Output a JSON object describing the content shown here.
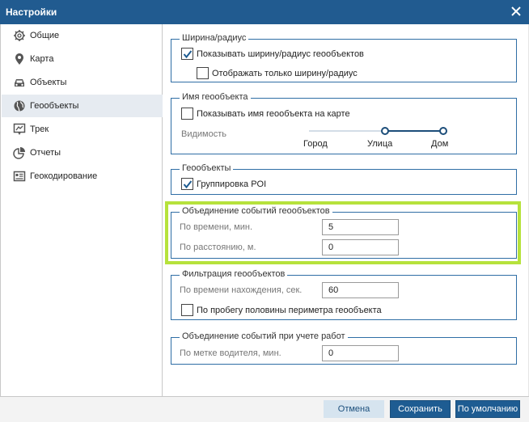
{
  "window": {
    "title": "Настройки"
  },
  "sidebar": {
    "items": [
      {
        "label": "Общие",
        "icon": "gear-icon"
      },
      {
        "label": "Карта",
        "icon": "map-pin-icon"
      },
      {
        "label": "Объекты",
        "icon": "car-icon"
      },
      {
        "label": "Геообъекты",
        "icon": "globe-icon",
        "active": true
      },
      {
        "label": "Трек",
        "icon": "track-icon"
      },
      {
        "label": "Отчеты",
        "icon": "pie-chart-icon"
      },
      {
        "label": "Геокодирование",
        "icon": "address-card-icon"
      }
    ]
  },
  "width_radius": {
    "legend": "Ширина/радиус",
    "show_width": {
      "label": "Показывать ширину/радиус геообъектов",
      "checked": true
    },
    "only_width": {
      "label": "Отображать только ширину/радиус",
      "checked": false
    }
  },
  "geo_name": {
    "legend": "Имя геообъекта",
    "show_name": {
      "label": "Показывать имя геообъекта на карте",
      "checked": false
    },
    "visibility": {
      "label": "Видимость",
      "ticks": [
        "Город",
        "Улица",
        "Дом"
      ],
      "range": [
        "Улица",
        "Дом"
      ]
    }
  },
  "geoobjects": {
    "legend": "Геообъекты",
    "grouping": {
      "label": "Группировка POI",
      "checked": true
    }
  },
  "merge_events": {
    "legend": "Объединение событий геообъектов",
    "by_time": {
      "label": "По времени, мин.",
      "value": "5"
    },
    "by_distance": {
      "label": "По расстоянию, м.",
      "value": "0"
    }
  },
  "filtering": {
    "legend": "Фильтрация геообъектов",
    "by_stay_time": {
      "label": "По времени нахождения, сек.",
      "value": "60"
    },
    "by_perimeter": {
      "label": "По пробегу половины периметра геообъекта",
      "checked": false
    }
  },
  "merge_work": {
    "legend": "Объединение событий при учете работ",
    "by_driver": {
      "label": "По метке водителя, мин.",
      "value": "0"
    }
  },
  "footer": {
    "cancel": "Отмена",
    "save": "Сохранить",
    "default": "По умолчанию"
  },
  "colors": {
    "titlebar": "#215b90",
    "accent": "#1e5c92",
    "highlight": "#b6e23c",
    "active_item": "#e6ebf1"
  }
}
